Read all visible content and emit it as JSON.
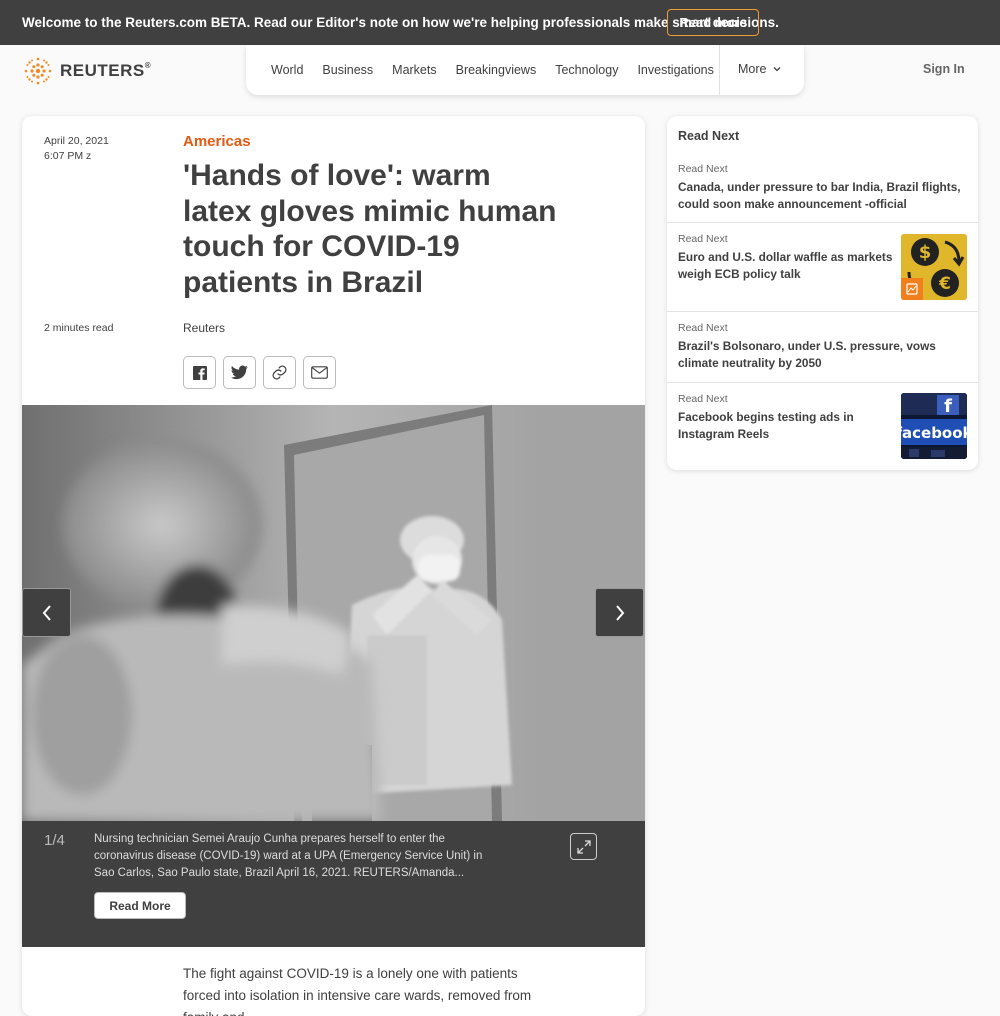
{
  "beta_bar": {
    "message": "Welcome to the Reuters.com BETA. Read our Editor's note on how we're helping professionals make smart decisions.",
    "button_label": "Read more"
  },
  "header": {
    "logo_text": "REUTERS",
    "logo_reg": "®",
    "nav": [
      "World",
      "Business",
      "Markets",
      "Breakingviews",
      "Technology",
      "Investigations"
    ],
    "more_label": "More",
    "signin_label": "Sign In"
  },
  "article": {
    "date": "April 20, 2021",
    "time": "6:07 PM z",
    "section": "Americas",
    "headline": "'Hands of love': warm latex gloves mimic human touch for COVID-19 patients in Brazil",
    "read_time": "2 minutes read",
    "author": "Reuters",
    "gallery": {
      "counter": "1/4",
      "caption": "Nursing technician Semei Araujo Cunha prepares herself to enter the coronavirus disease (COVID-19) ward at a UPA (Emergency Service Unit) in Sao Carlos, Sao Paulo state, Brazil April 16, 2021. REUTERS/Amanda...",
      "read_more_label": "Read More"
    },
    "body": "The fight against COVID-19 is a lonely one with patients forced into isolation in intensive care wards, removed from family and"
  },
  "sidebar": {
    "title": "Read Next",
    "items": [
      {
        "kicker": "Read Next",
        "headline": "Canada, under pressure to bar India, Brazil flights, could soon make announcement -official"
      },
      {
        "kicker": "Read Next",
        "headline": "Euro and U.S. dollar waffle as markets weigh ECB policy talk"
      },
      {
        "kicker": "Read Next",
        "headline": "Brazil's Bolsonaro, under U.S. pressure, vows climate neutrality by 2050"
      },
      {
        "kicker": "Read Next",
        "headline": "Facebook begins testing ads in Instagram Reels",
        "thumb_text": "facebook"
      }
    ]
  },
  "colors": {
    "accent_orange": "#e35a12",
    "dark_bar": "#404040",
    "button_outline": "#ef9c32"
  }
}
